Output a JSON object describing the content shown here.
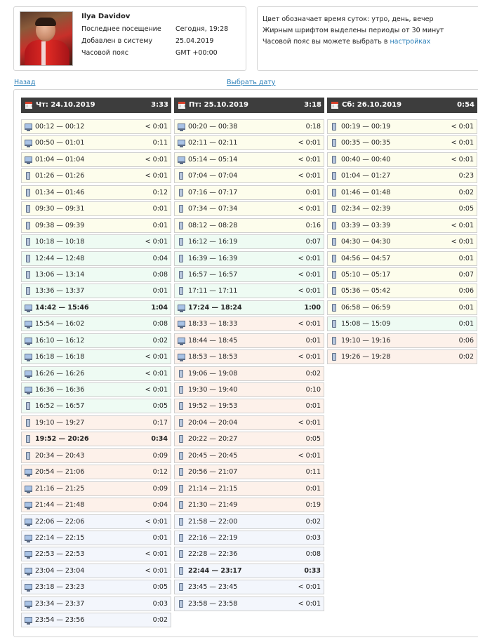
{
  "profile": {
    "name": "Ilya Davidov",
    "rows": [
      {
        "label": "Последнее посещение",
        "value": "Сегодня, 19:28"
      },
      {
        "label": "Добавлен в систему",
        "value": "25.04.2019"
      },
      {
        "label": "Часовой пояс",
        "value": "GMT +00:00"
      }
    ]
  },
  "legend": {
    "line1": "Цвет обозначает время суток: утро, день, вечер",
    "line2": "Жирным шрифтом выделены периоды от 30 минут",
    "line3_prefix": "Часовой пояс вы можете выбрать в ",
    "line3_link": "настройках"
  },
  "nav": {
    "back": "Назад",
    "choose_date": "Выбрать дату"
  },
  "colors": {
    "morning": "#fdfdec",
    "day": "#eefbf3",
    "evening": "#fdf1ea",
    "night": "#f3f6fc",
    "header": "#3d3d3d",
    "link": "#2a7fb8"
  },
  "days": [
    {
      "date": "Чт: 24.10.2019",
      "total": "3:33",
      "sessions": [
        {
          "range": "00:12 — 00:12",
          "dur": "< 0:01",
          "device": "pc",
          "period": "morning"
        },
        {
          "range": "00:50 — 01:01",
          "dur": "0:11",
          "device": "pc",
          "period": "morning"
        },
        {
          "range": "01:04 — 01:04",
          "dur": "< 0:01",
          "device": "pc",
          "period": "morning"
        },
        {
          "range": "01:26 — 01:26",
          "dur": "< 0:01",
          "device": "mobile",
          "period": "morning"
        },
        {
          "range": "01:34 — 01:46",
          "dur": "0:12",
          "device": "mobile",
          "period": "morning"
        },
        {
          "range": "09:30 — 09:31",
          "dur": "0:01",
          "device": "mobile",
          "period": "morning"
        },
        {
          "range": "09:38 — 09:39",
          "dur": "0:01",
          "device": "mobile",
          "period": "morning"
        },
        {
          "range": "10:18 — 10:18",
          "dur": "< 0:01",
          "device": "mobile",
          "period": "day"
        },
        {
          "range": "12:44 — 12:48",
          "dur": "0:04",
          "device": "mobile",
          "period": "day"
        },
        {
          "range": "13:06 — 13:14",
          "dur": "0:08",
          "device": "mobile",
          "period": "day"
        },
        {
          "range": "13:36 — 13:37",
          "dur": "0:01",
          "device": "mobile",
          "period": "day"
        },
        {
          "range": "14:42 — 15:46",
          "dur": "1:04",
          "device": "pc",
          "period": "day",
          "bold": true
        },
        {
          "range": "15:54 — 16:02",
          "dur": "0:08",
          "device": "pc",
          "period": "day"
        },
        {
          "range": "16:10 — 16:12",
          "dur": "0:02",
          "device": "pc",
          "period": "day"
        },
        {
          "range": "16:18 — 16:18",
          "dur": "< 0:01",
          "device": "pc",
          "period": "day"
        },
        {
          "range": "16:26 — 16:26",
          "dur": "< 0:01",
          "device": "pc",
          "period": "day"
        },
        {
          "range": "16:36 — 16:36",
          "dur": "< 0:01",
          "device": "pc",
          "period": "day"
        },
        {
          "range": "16:52 — 16:57",
          "dur": "0:05",
          "device": "mobile",
          "period": "day"
        },
        {
          "range": "19:10 — 19:27",
          "dur": "0:17",
          "device": "mobile",
          "period": "evening"
        },
        {
          "range": "19:52 — 20:26",
          "dur": "0:34",
          "device": "mobile",
          "period": "evening",
          "bold": true
        },
        {
          "range": "20:34 — 20:43",
          "dur": "0:09",
          "device": "mobile",
          "period": "evening"
        },
        {
          "range": "20:54 — 21:06",
          "dur": "0:12",
          "device": "pc",
          "period": "evening"
        },
        {
          "range": "21:16 — 21:25",
          "dur": "0:09",
          "device": "pc",
          "period": "evening"
        },
        {
          "range": "21:44 — 21:48",
          "dur": "0:04",
          "device": "pc",
          "period": "evening"
        },
        {
          "range": "22:06 — 22:06",
          "dur": "< 0:01",
          "device": "pc",
          "period": "night"
        },
        {
          "range": "22:14 — 22:15",
          "dur": "0:01",
          "device": "pc",
          "period": "night"
        },
        {
          "range": "22:53 — 22:53",
          "dur": "< 0:01",
          "device": "pc",
          "period": "night"
        },
        {
          "range": "23:04 — 23:04",
          "dur": "< 0:01",
          "device": "pc",
          "period": "night"
        },
        {
          "range": "23:18 — 23:23",
          "dur": "0:05",
          "device": "pc",
          "period": "night"
        },
        {
          "range": "23:34 — 23:37",
          "dur": "0:03",
          "device": "pc",
          "period": "night"
        },
        {
          "range": "23:54 — 23:56",
          "dur": "0:02",
          "device": "pc",
          "period": "night"
        }
      ]
    },
    {
      "date": "Пт: 25.10.2019",
      "total": "3:18",
      "sessions": [
        {
          "range": "00:20 — 00:38",
          "dur": "0:18",
          "device": "pc",
          "period": "morning"
        },
        {
          "range": "02:11 — 02:11",
          "dur": "< 0:01",
          "device": "pc",
          "period": "morning"
        },
        {
          "range": "05:14 — 05:14",
          "dur": "< 0:01",
          "device": "pc",
          "period": "morning"
        },
        {
          "range": "07:04 — 07:04",
          "dur": "< 0:01",
          "device": "mobile",
          "period": "morning"
        },
        {
          "range": "07:16 — 07:17",
          "dur": "0:01",
          "device": "mobile",
          "period": "morning"
        },
        {
          "range": "07:34 — 07:34",
          "dur": "< 0:01",
          "device": "mobile",
          "period": "morning"
        },
        {
          "range": "08:12 — 08:28",
          "dur": "0:16",
          "device": "mobile",
          "period": "morning"
        },
        {
          "range": "16:12 — 16:19",
          "dur": "0:07",
          "device": "mobile",
          "period": "day"
        },
        {
          "range": "16:39 — 16:39",
          "dur": "< 0:01",
          "device": "mobile",
          "period": "day"
        },
        {
          "range": "16:57 — 16:57",
          "dur": "< 0:01",
          "device": "mobile",
          "period": "day"
        },
        {
          "range": "17:11 — 17:11",
          "dur": "< 0:01",
          "device": "mobile",
          "period": "day"
        },
        {
          "range": "17:24 — 18:24",
          "dur": "1:00",
          "device": "pc",
          "period": "day",
          "bold": true
        },
        {
          "range": "18:33 — 18:33",
          "dur": "< 0:01",
          "device": "pc",
          "period": "evening"
        },
        {
          "range": "18:44 — 18:45",
          "dur": "0:01",
          "device": "pc",
          "period": "evening"
        },
        {
          "range": "18:53 — 18:53",
          "dur": "< 0:01",
          "device": "pc",
          "period": "evening"
        },
        {
          "range": "19:06 — 19:08",
          "dur": "0:02",
          "device": "mobile",
          "period": "evening"
        },
        {
          "range": "19:30 — 19:40",
          "dur": "0:10",
          "device": "mobile",
          "period": "evening"
        },
        {
          "range": "19:52 — 19:53",
          "dur": "0:01",
          "device": "mobile",
          "period": "evening"
        },
        {
          "range": "20:04 — 20:04",
          "dur": "< 0:01",
          "device": "mobile",
          "period": "evening"
        },
        {
          "range": "20:22 — 20:27",
          "dur": "0:05",
          "device": "mobile",
          "period": "evening"
        },
        {
          "range": "20:45 — 20:45",
          "dur": "< 0:01",
          "device": "mobile",
          "period": "evening"
        },
        {
          "range": "20:56 — 21:07",
          "dur": "0:11",
          "device": "mobile",
          "period": "evening"
        },
        {
          "range": "21:14 — 21:15",
          "dur": "0:01",
          "device": "mobile",
          "period": "evening"
        },
        {
          "range": "21:30 — 21:49",
          "dur": "0:19",
          "device": "mobile",
          "period": "evening"
        },
        {
          "range": "21:58 — 22:00",
          "dur": "0:02",
          "device": "mobile",
          "period": "night"
        },
        {
          "range": "22:16 — 22:19",
          "dur": "0:03",
          "device": "mobile",
          "period": "night"
        },
        {
          "range": "22:28 — 22:36",
          "dur": "0:08",
          "device": "mobile",
          "period": "night"
        },
        {
          "range": "22:44 — 23:17",
          "dur": "0:33",
          "device": "mobile",
          "period": "night",
          "bold": true
        },
        {
          "range": "23:45 — 23:45",
          "dur": "< 0:01",
          "device": "mobile",
          "period": "night"
        },
        {
          "range": "23:58 — 23:58",
          "dur": "< 0:01",
          "device": "mobile",
          "period": "night"
        }
      ]
    },
    {
      "date": "Сб: 26.10.2019",
      "total": "0:54",
      "sessions": [
        {
          "range": "00:19 — 00:19",
          "dur": "< 0:01",
          "device": "mobile",
          "period": "morning"
        },
        {
          "range": "00:35 — 00:35",
          "dur": "< 0:01",
          "device": "mobile",
          "period": "morning"
        },
        {
          "range": "00:40 — 00:40",
          "dur": "< 0:01",
          "device": "mobile",
          "period": "morning"
        },
        {
          "range": "01:04 — 01:27",
          "dur": "0:23",
          "device": "mobile",
          "period": "morning"
        },
        {
          "range": "01:46 — 01:48",
          "dur": "0:02",
          "device": "mobile",
          "period": "morning"
        },
        {
          "range": "02:34 — 02:39",
          "dur": "0:05",
          "device": "mobile",
          "period": "morning"
        },
        {
          "range": "03:39 — 03:39",
          "dur": "< 0:01",
          "device": "mobile",
          "period": "morning"
        },
        {
          "range": "04:30 — 04:30",
          "dur": "< 0:01",
          "device": "mobile",
          "period": "morning"
        },
        {
          "range": "04:56 — 04:57",
          "dur": "0:01",
          "device": "mobile",
          "period": "morning"
        },
        {
          "range": "05:10 — 05:17",
          "dur": "0:07",
          "device": "mobile",
          "period": "morning"
        },
        {
          "range": "05:36 — 05:42",
          "dur": "0:06",
          "device": "mobile",
          "period": "morning"
        },
        {
          "range": "06:58 — 06:59",
          "dur": "0:01",
          "device": "mobile",
          "period": "morning"
        },
        {
          "range": "15:08 — 15:09",
          "dur": "0:01",
          "device": "mobile",
          "period": "day"
        },
        {
          "range": "19:10 — 19:16",
          "dur": "0:06",
          "device": "mobile",
          "period": "evening"
        },
        {
          "range": "19:26 — 19:28",
          "dur": "0:02",
          "device": "mobile",
          "period": "evening"
        }
      ]
    }
  ]
}
